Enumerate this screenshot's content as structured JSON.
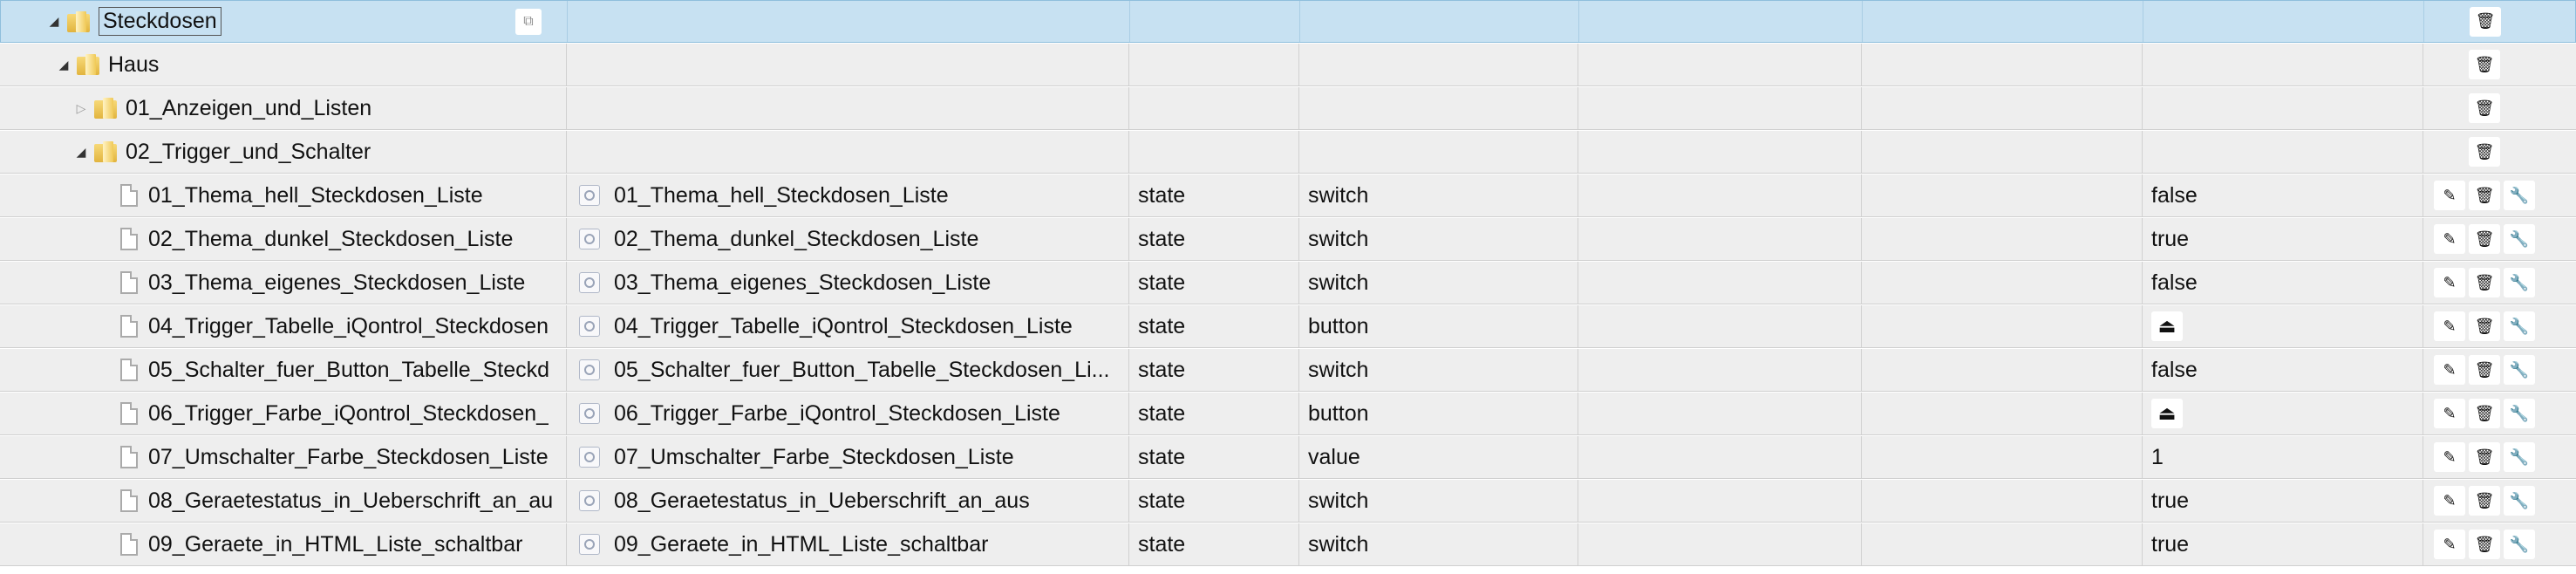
{
  "tree": {
    "root": {
      "name": "Steckdosen",
      "expanded": true
    },
    "haus": {
      "name": "Haus",
      "expanded": true
    },
    "folder1": {
      "name": "01_Anzeigen_und_Listen",
      "expanded": false
    },
    "folder2": {
      "name": "02_Trigger_und_Schalter",
      "expanded": true
    },
    "states": [
      {
        "id": "01_Thema_hell_Steckdosen_Liste",
        "name": "01_Thema_hell_Steckdosen_Liste",
        "type": "state",
        "role": "switch",
        "value": "false"
      },
      {
        "id": "02_Thema_dunkel_Steckdosen_Liste",
        "name": "02_Thema_dunkel_Steckdosen_Liste",
        "type": "state",
        "role": "switch",
        "value": "true"
      },
      {
        "id": "03_Thema_eigenes_Steckdosen_Liste",
        "name": "03_Thema_eigenes_Steckdosen_Liste",
        "type": "state",
        "role": "switch",
        "value": "false"
      },
      {
        "id": "04_Trigger_Tabelle_iQontrol_Steckdosen",
        "name": "04_Trigger_Tabelle_iQontrol_Steckdosen_Liste",
        "type": "state",
        "role": "button",
        "value": ""
      },
      {
        "id": "05_Schalter_fuer_Button_Tabelle_Steckd",
        "name": "05_Schalter_fuer_Button_Tabelle_Steckdosen_Li...",
        "type": "state",
        "role": "switch",
        "value": "false"
      },
      {
        "id": "06_Trigger_Farbe_iQontrol_Steckdosen_",
        "name": "06_Trigger_Farbe_iQontrol_Steckdosen_Liste",
        "type": "state",
        "role": "button",
        "value": ""
      },
      {
        "id": "07_Umschalter_Farbe_Steckdosen_Liste",
        "name": "07_Umschalter_Farbe_Steckdosen_Liste",
        "type": "state",
        "role": "value",
        "value": "1"
      },
      {
        "id": "08_Geraetestatus_in_Ueberschrift_an_au",
        "name": "08_Geraetestatus_in_Ueberschrift_an_aus",
        "type": "state",
        "role": "switch",
        "value": "true"
      },
      {
        "id": "09_Geraete_in_HTML_Liste_schaltbar",
        "name": "09_Geraete_in_HTML_Liste_schaltbar",
        "type": "state",
        "role": "switch",
        "value": "true"
      }
    ]
  },
  "icons": {
    "expander_open": "triangle-down-icon",
    "expander_closed": "triangle-right-icon",
    "folder": "folder-icon",
    "file": "file-icon",
    "label": "state-icon",
    "copy": "copy-icon",
    "edit": "pencil-icon",
    "delete": "trash-icon",
    "settings": "wrench-icon",
    "button_value": "bell-icon"
  },
  "colors": {
    "row_bg": "#eeeeee",
    "selected_bg": "#c7e1f2"
  }
}
